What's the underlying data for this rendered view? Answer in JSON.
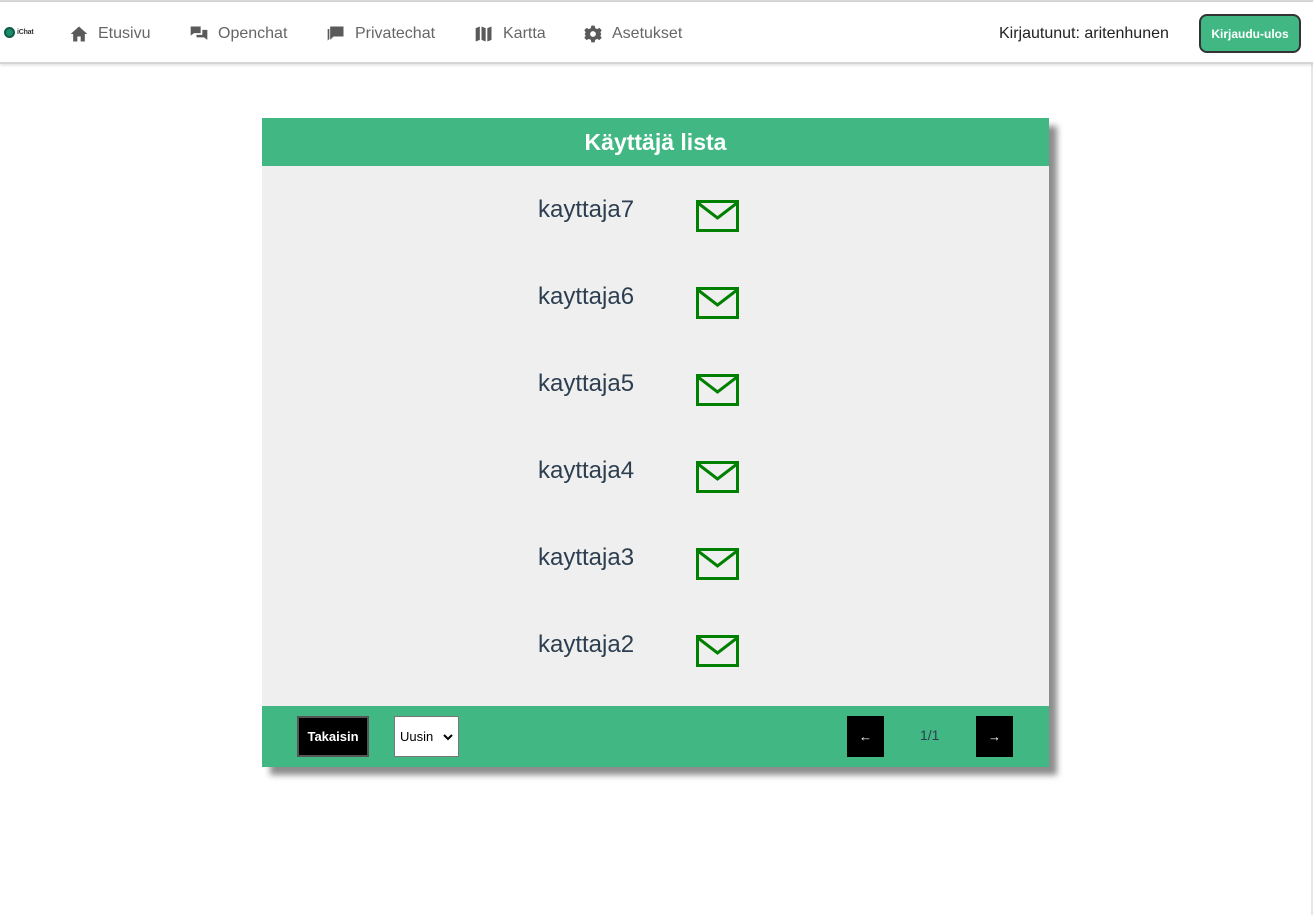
{
  "app": {
    "logo_text": "iChat"
  },
  "nav": {
    "items": [
      {
        "label": "Etusivu",
        "icon": "home-icon"
      },
      {
        "label": "Openchat",
        "icon": "chat-bubbles-icon"
      },
      {
        "label": "Privatechat",
        "icon": "private-chat-icon"
      },
      {
        "label": "Kartta",
        "icon": "map-icon"
      },
      {
        "label": "Asetukset",
        "icon": "gear-icon"
      }
    ],
    "logged_in": "Kirjautunut: aritenhunen",
    "logout_label": "Kirjaudu-ulos"
  },
  "user_list": {
    "title": "Käyttäjä lista",
    "users": [
      {
        "name": "kayttaja7",
        "icon": "mail-icon"
      },
      {
        "name": "kayttaja6",
        "icon": "mail-icon"
      },
      {
        "name": "kayttaja5",
        "icon": "mail-icon"
      },
      {
        "name": "kayttaja4",
        "icon": "mail-icon"
      },
      {
        "name": "kayttaja3",
        "icon": "mail-icon"
      },
      {
        "name": "kayttaja2",
        "icon": "mail-icon"
      }
    ],
    "footer": {
      "back_label": "Takaisin",
      "sort_selected": "Uusin",
      "prev_label": "←",
      "next_label": "→",
      "page": "1/1"
    }
  },
  "colors": {
    "accent": "#41b883",
    "mail_icon": "#008000",
    "panel_bg": "#efefef",
    "name_text": "#2c3e50"
  }
}
